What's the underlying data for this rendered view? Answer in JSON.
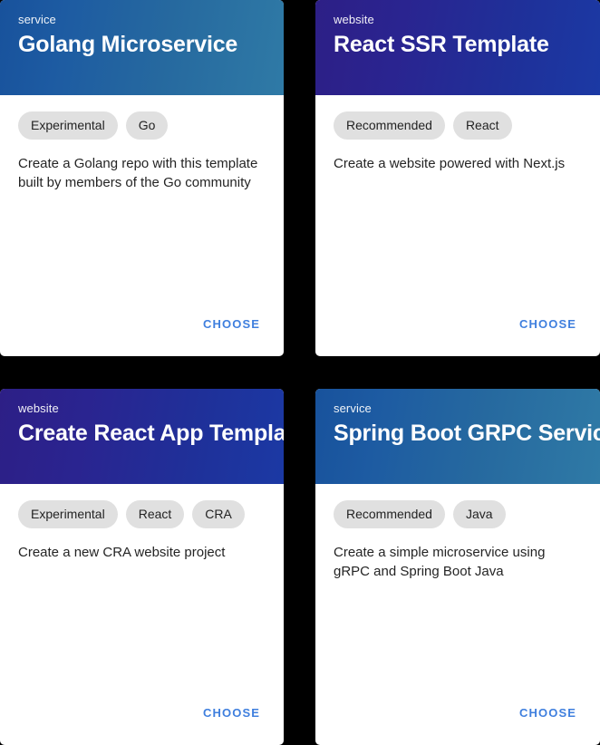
{
  "accent_color": "#3f7fde",
  "chip_bg_color": "#e0e0e0",
  "card_bg_color": "#ffffff",
  "page_bg_color": "#000000",
  "choose_label": "CHOOSE",
  "cards": [
    {
      "kicker": "service",
      "title": "Golang Microservice",
      "header_gradient_from": "#18529c",
      "header_gradient_to": "#2f7aa6",
      "chips": [
        "Experimental",
        "Go"
      ],
      "description": "Create a Golang repo with this template built by members of the Go community",
      "action_label": "CHOOSE"
    },
    {
      "kicker": "website",
      "title": "React SSR Template",
      "header_gradient_from": "#2d1f86",
      "header_gradient_to": "#1b39a4",
      "chips": [
        "Recommended",
        "React"
      ],
      "description": "Create a website powered with Next.js",
      "action_label": "CHOOSE"
    },
    {
      "kicker": "website",
      "title": "Create React App Template",
      "header_gradient_from": "#2d1f86",
      "header_gradient_to": "#1b39a4",
      "chips": [
        "Experimental",
        "React",
        "CRA"
      ],
      "description": "Create a new CRA website project",
      "action_label": "CHOOSE"
    },
    {
      "kicker": "service",
      "title": "Spring Boot GRPC Service",
      "header_gradient_from": "#18529c",
      "header_gradient_to": "#2f7aa6",
      "chips": [
        "Recommended",
        "Java"
      ],
      "description": "Create a simple microservice using gRPC and Spring Boot Java",
      "action_label": "CHOOSE"
    }
  ]
}
